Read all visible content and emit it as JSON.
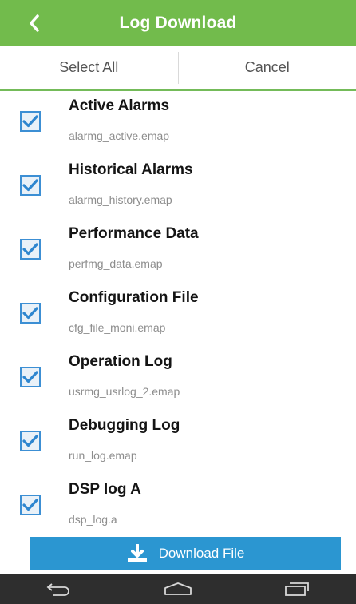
{
  "header": {
    "title": "Log Download",
    "back_icon": "chevron-left-icon",
    "color": "#72bb4c"
  },
  "actions": {
    "select_all": "Select All",
    "cancel": "Cancel"
  },
  "items": [
    {
      "title": "Active Alarms",
      "file": "alarmg_active.emap",
      "checked": true
    },
    {
      "title": "Historical Alarms",
      "file": "alarmg_history.emap",
      "checked": true
    },
    {
      "title": "Performance Data",
      "file": "perfmg_data.emap",
      "checked": true
    },
    {
      "title": "Configuration File",
      "file": "cfg_file_moni.emap",
      "checked": true
    },
    {
      "title": "Operation Log",
      "file": "usrmg_usrlog_2.emap",
      "checked": true
    },
    {
      "title": "Debugging Log",
      "file": "run_log.emap",
      "checked": true
    },
    {
      "title": "DSP log A",
      "file": "dsp_log.a",
      "checked": true
    }
  ],
  "download": {
    "label": "Download File",
    "icon": "download-icon",
    "color": "#2b96d1"
  },
  "navbar": {
    "back_icon": "back-icon",
    "home_icon": "home-icon",
    "recent_icon": "recent-apps-icon"
  }
}
